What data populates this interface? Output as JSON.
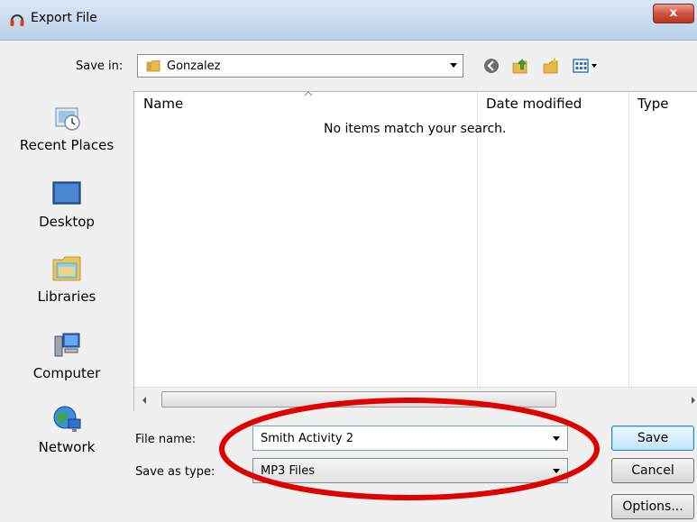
{
  "window": {
    "title": "Export File",
    "close_glyph": "x"
  },
  "toolbar": {
    "save_in_label": "Save in:",
    "save_in_value": "Gonzalez",
    "icons": [
      "back-icon",
      "up-folder-icon",
      "new-folder-icon",
      "view-menu-icon"
    ]
  },
  "places": [
    {
      "label": "Recent Places",
      "icon": "recent-places-icon"
    },
    {
      "label": "Desktop",
      "icon": "desktop-icon"
    },
    {
      "label": "Libraries",
      "icon": "libraries-icon"
    },
    {
      "label": "Computer",
      "icon": "computer-icon"
    },
    {
      "label": "Network",
      "icon": "network-icon"
    }
  ],
  "filelist": {
    "columns": [
      "Name",
      "Date modified",
      "Type"
    ],
    "empty_message": "No items match your search."
  },
  "form": {
    "file_name_label": "File name:",
    "file_name_value": "Smith Activity 2",
    "save_type_label": "Save as type:",
    "save_type_value": "MP3 Files"
  },
  "buttons": {
    "save": "Save",
    "cancel": "Cancel",
    "options": "Options..."
  },
  "colors": {
    "annotation_ellipse": "#e00000",
    "title_bar": "#c9dcef"
  }
}
